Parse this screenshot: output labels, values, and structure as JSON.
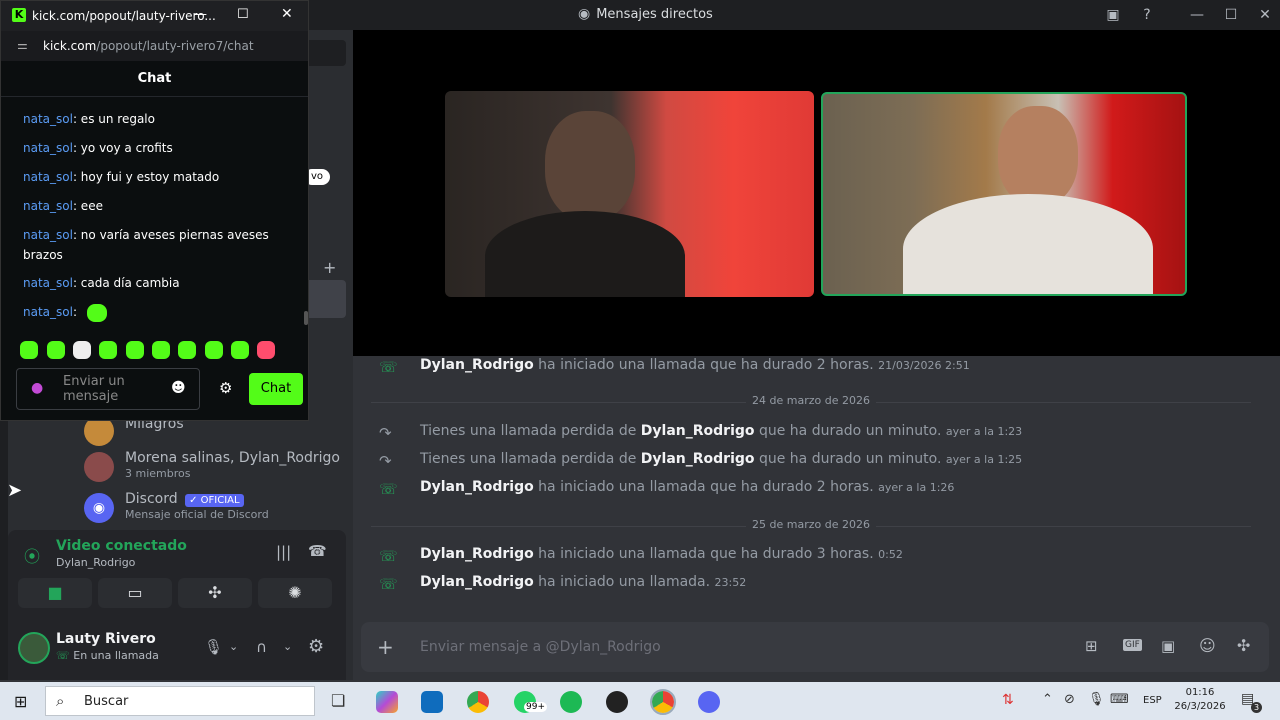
{
  "discord": {
    "window_title": "Mensajes directos",
    "dm_list": [
      {
        "name": "Milagros",
        "sub": ""
      },
      {
        "name": "Morena salinas, Dylan_Rodrigo",
        "sub": "3 miembros"
      },
      {
        "name": "Discord",
        "badge": "✓ OFICIAL",
        "sub": "Mensaje oficial de Discord"
      }
    ],
    "voice": {
      "status": "Video conectado",
      "channel": "Dylan_Rodrigo"
    },
    "user": {
      "name": "Lauty Rivero",
      "status": "En una llamada"
    },
    "peek_label": "vo",
    "composer_placeholder": "Enviar mensaje a @Dylan_Rodrigo",
    "messages": [
      {
        "type": "call",
        "actor": "Dylan_Rodrigo",
        "text": " ha iniciado una llamada que ha durado 2 horas.",
        "time": "21/03/2026 2:51",
        "color": "#23a55a"
      },
      {
        "type": "date",
        "text": "24 de marzo de 2026"
      },
      {
        "type": "missed",
        "pre": "Tienes una llamada perdida de ",
        "actor": "Dylan_Rodrigo",
        "text": " que ha durado un minuto.",
        "time": "ayer a la 1:23",
        "color": "#949ba4"
      },
      {
        "type": "missed",
        "pre": "Tienes una llamada perdida de ",
        "actor": "Dylan_Rodrigo",
        "text": " que ha durado un minuto.",
        "time": "ayer a la 1:25",
        "color": "#949ba4"
      },
      {
        "type": "call",
        "actor": "Dylan_Rodrigo",
        "text": " ha iniciado una llamada que ha durado 2 horas.",
        "time": "ayer a la 1:26",
        "color": "#23a55a"
      },
      {
        "type": "date",
        "text": "25 de marzo de 2026"
      },
      {
        "type": "call",
        "actor": "Dylan_Rodrigo",
        "text": " ha iniciado una llamada que ha durado 3 horas.",
        "time": "0:52",
        "color": "#23a55a"
      },
      {
        "type": "call",
        "actor": "Dylan_Rodrigo",
        "text": " ha iniciado una llamada.",
        "time": "23:52",
        "color": "#23a55a"
      }
    ]
  },
  "kick": {
    "window_title": "kick.com/popout/lauty-rivero...",
    "url_host": "kick.com",
    "url_path": "/popout/lauty-rivero7/chat",
    "header": "Chat",
    "lines": [
      {
        "user": "nata_sol",
        "text": ": es un regalo"
      },
      {
        "user": "nata_sol",
        "text": ": yo voy a crofits"
      },
      {
        "user": "nata_sol",
        "text": ": hoy fui y estoy matado"
      },
      {
        "user": "nata_sol",
        "text": ": eee"
      },
      {
        "user": "nata_sol",
        "text": ": no varía aveses piernas aveses brazos"
      },
      {
        "user": "nata_sol",
        "text": ": cada día cambia"
      },
      {
        "user": "nata_sol",
        "text": ":"
      }
    ],
    "input_placeholder": "Enviar un mensaje",
    "send_label": "Chat",
    "accent": "#53fc18"
  },
  "taskbar": {
    "search_placeholder": "Buscar",
    "whatsapp_badge": "99+",
    "language": "ESP",
    "time": "01:16",
    "date": "26/3/2026",
    "notif_count": "3"
  }
}
